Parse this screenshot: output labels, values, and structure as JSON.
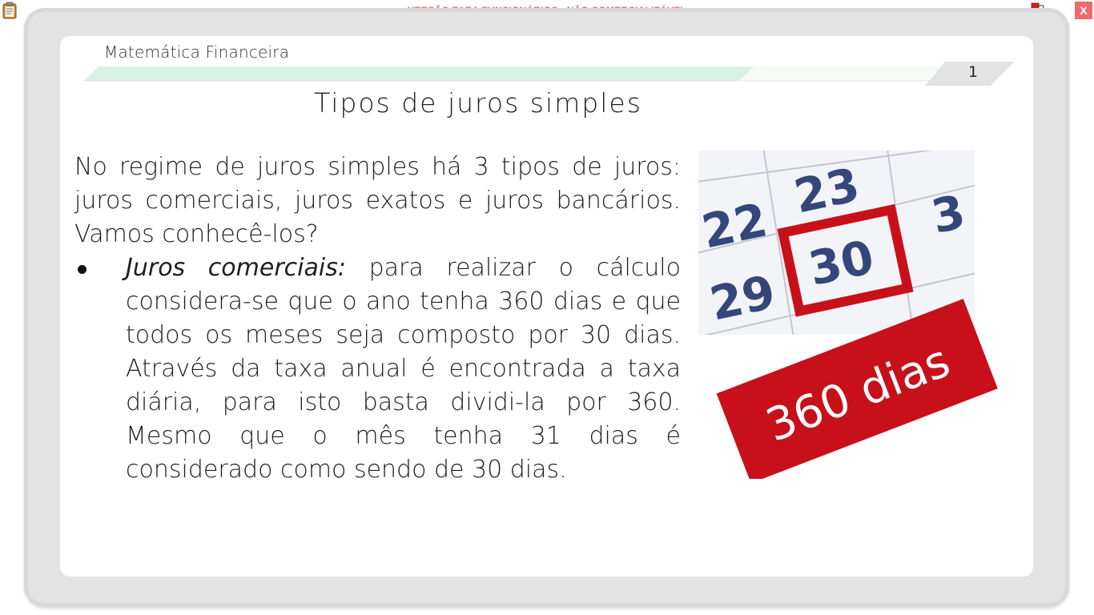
{
  "toolbar": {
    "watermark": "VERSÃO PARA FUNCIONÁRIOS - NÃO COMERCIALIZÁVEL",
    "close_label": "X",
    "clipboard_icon": "clipboard-icon",
    "tools_icon": "network-tools-icon"
  },
  "slide": {
    "subject": "Matemática Financeira",
    "page_number": "1",
    "title": "Tipos de juros simples",
    "intro": "No regime de juros simples há 3 tipos de juros: juros comerciais, juros exatos e juros bancários. Vamos conhecê-los?",
    "bullets": [
      {
        "term": "Juros comerciais:",
        "text": " para realizar o cálculo considera-se que o ano tenha 360 dias e que todos os meses seja composto por 30 dias. Através da taxa anual é encontrada a taxa diária, para isto basta dividi-la por 360. Mesmo que o mês tenha 31 dias é considerado como sendo de 30 dias."
      }
    ]
  },
  "image": {
    "calendar_numbers": [
      "22",
      "23",
      "30",
      "29",
      "3"
    ],
    "banner_text": "360 dias",
    "colors": {
      "accent_red": "#c8101a",
      "calendar_digits": "#34467a",
      "header_band": "#d8f3e6"
    }
  }
}
